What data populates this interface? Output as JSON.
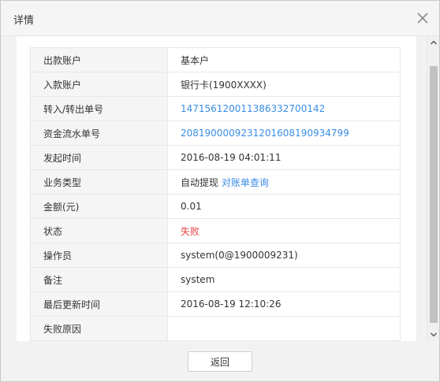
{
  "dialog": {
    "title": "详情",
    "close_icon": "close-icon"
  },
  "details": {
    "rows": [
      {
        "key": "出款账户",
        "value": "基本户"
      },
      {
        "key": "入款账户",
        "value": "银行卡(1900XXXX)"
      },
      {
        "key": "转入/转出单号",
        "value": "14715612001138633270014​2"
      },
      {
        "key": "资金流水单号",
        "value": "20819000092312016081909347​99"
      },
      {
        "key": "发起时间",
        "value": "2016-08-19 04:01:11"
      },
      {
        "key": "业务类型",
        "value": "自动提现",
        "link": "对账单查询"
      },
      {
        "key": "金额(元)",
        "value": "0.01"
      },
      {
        "key": "状态",
        "value": "失败"
      },
      {
        "key": "操作员",
        "value": "system(0@1900009231)"
      },
      {
        "key": "备注",
        "value": "system"
      },
      {
        "key": "最后更新时间",
        "value": "2016-08-19 12:10:26"
      },
      {
        "key": "失败原因",
        "value": ""
      }
    ]
  },
  "footer": {
    "back_label": "返回"
  },
  "colors": {
    "link": "#3a8ee6",
    "fail": "#e64340",
    "key_bg": "#f5f5f5"
  }
}
